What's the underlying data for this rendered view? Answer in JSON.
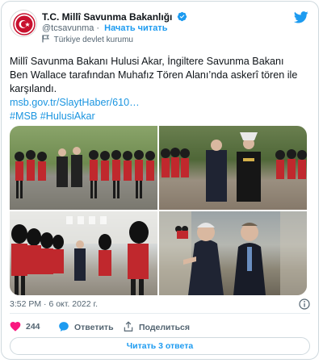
{
  "account": {
    "display_name": "T.C. Millî Savunma Bakanlığı",
    "handle": "@tcsavunma",
    "separator": "·",
    "follow_label": "Начать читать",
    "label": "Türkiye devlet kurumu"
  },
  "tweet": {
    "text": "Millî Savunma Bakanı Hulusi Akar, İngiltere Savunma Bakanı Ben Wallace tarafından Muhafız Tören Alanı’nda askerî tören ile karşılandı.",
    "link": "msb.gov.tr/SlaytHaber/610…",
    "hashtag1": "#MSB",
    "hashtag2": "#HulusiAkar"
  },
  "photos": [
    "photo-1",
    "photo-2",
    "photo-3",
    "photo-4"
  ],
  "meta": {
    "time": "3:52 PM",
    "separator": "·",
    "date": "6 окт. 2022 г."
  },
  "actions": {
    "likes_count": "244",
    "reply_label": "Ответить",
    "share_label": "Поделиться"
  },
  "replies_button": "Читать 3 ответа",
  "colors": {
    "accent": "#1d9bf0",
    "like": "#f91880",
    "text_secondary": "#536471"
  },
  "icons": {
    "verified": "verified-icon",
    "twitter": "twitter-icon",
    "flag": "flag-icon",
    "like": "heart-icon",
    "reply": "reply-icon",
    "share": "share-icon",
    "info": "info-icon"
  }
}
